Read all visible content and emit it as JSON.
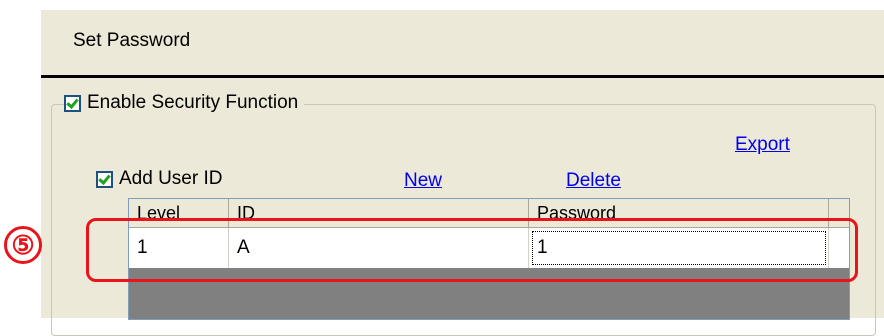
{
  "dialog": {
    "title": "Set Password"
  },
  "security": {
    "enable_label": "Enable Security Function",
    "enable_checked": true,
    "export_link": "Export"
  },
  "users": {
    "add_user_label": "Add User ID",
    "add_user_checked": true,
    "new_link": "New",
    "delete_link": "Delete",
    "columns": [
      "Level",
      "ID",
      "Password"
    ],
    "rows": [
      {
        "level": "1",
        "id": "A",
        "password": "1"
      }
    ]
  },
  "annotation": {
    "step_marker": "⑤",
    "highlight_color": "#e8141a"
  },
  "colors": {
    "dialog_bg": "#ece9d8",
    "link": "#0000ee",
    "grid_empty": "#808080"
  }
}
